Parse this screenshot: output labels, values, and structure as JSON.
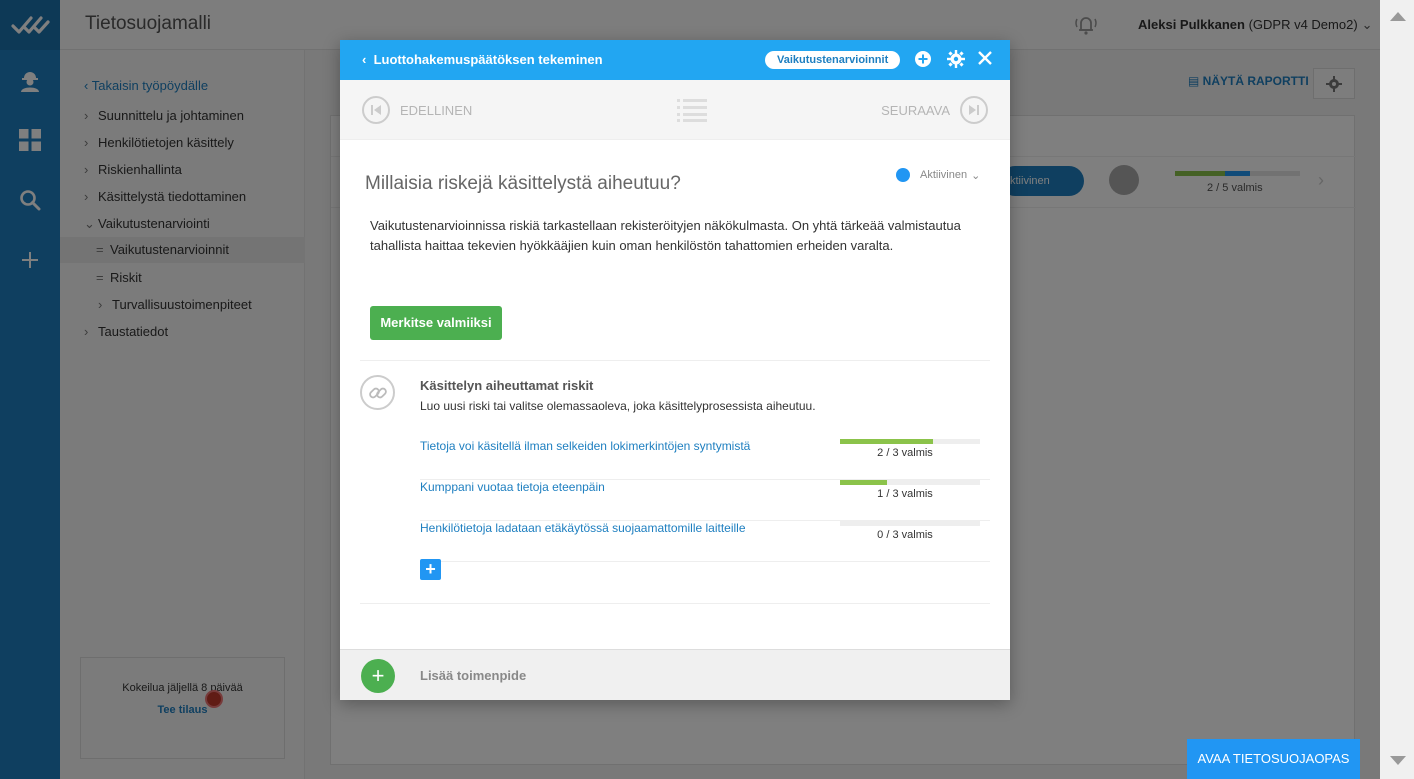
{
  "app": {
    "title": "Tietosuojamalli",
    "user_name": "Aleksi Pulkkanen",
    "user_org": " (GDPR v4 Demo2)"
  },
  "sidebar": {
    "back_label": "Takaisin työpöydälle",
    "items": [
      {
        "label": "Suunnittelu ja johtaminen",
        "marker": "›"
      },
      {
        "label": "Henkilötietojen käsittely",
        "marker": "›"
      },
      {
        "label": "Riskienhallinta",
        "marker": "›"
      },
      {
        "label": "Käsittelystä tiedottaminen",
        "marker": "›"
      },
      {
        "label": "Vaikutustenarviointi",
        "marker": "⌄"
      },
      {
        "label": "Vaikutustenarvioinnit",
        "marker": "="
      },
      {
        "label": "Riskit",
        "marker": "="
      },
      {
        "label": "Turvallisuustoimenpiteet",
        "marker": "›"
      },
      {
        "label": "Taustatiedot",
        "marker": "›"
      }
    ],
    "trial_text": "Kokeilua jäljellä 8 päivää",
    "trial_link": "Tee tilaus"
  },
  "main": {
    "report_label": "NÄYTÄ RAPORTTI",
    "status_pill": "ktiivinen",
    "progress_label": "2 / 5 valmis"
  },
  "guide_button": "AVAA TIETOSUOJAOPAS",
  "modal": {
    "header_title": "Luottohakemuspäätöksen tekeminen",
    "header_tag": "Vaikutustenarvioinnit",
    "prev_label": "EDELLINEN",
    "next_label": "SEURAAVA",
    "question": "Millaisia riskejä käsittelystä aiheutuu?",
    "status": "Aktiivinen",
    "description": "Vaikutustenarvioinnissa riskiä tarkastellaan rekisteröityjen näkökulmasta. On yhtä tärkeää valmistautua tahallista haittaa tekevien hyökkääjien kuin oman henkilöstön tahattomien erheiden varalta.",
    "done_button": "Merkitse valmiiksi",
    "section_title": "Käsittelyn aiheuttamat riskit",
    "section_subtitle": "Luo uusi riski tai valitse olemassaoleva, joka käsittelyprosessista aiheutuu.",
    "risks": [
      {
        "name": "Tietoja voi käsitellä ilman selkeiden lokimerkintöjen syntymistä",
        "progress_label": "2 / 3 valmis",
        "progress": 0.667
      },
      {
        "name": "Kumppani vuotaa tietoja eteenpäin",
        "progress_label": "1 / 3 valmis",
        "progress": 0.333
      },
      {
        "name": "Henkilötietoja ladataan etäkäytössä suojaamattomille laitteille",
        "progress_label": "0 / 3 valmis",
        "progress": 0
      }
    ],
    "add_action": "Lisää toimenpide"
  },
  "colors": {
    "rail": "#1e7fc0",
    "header": "#22a6f2",
    "green": "#4caf50",
    "progress_green": "#8bc34a",
    "link": "#1e7fc0"
  }
}
